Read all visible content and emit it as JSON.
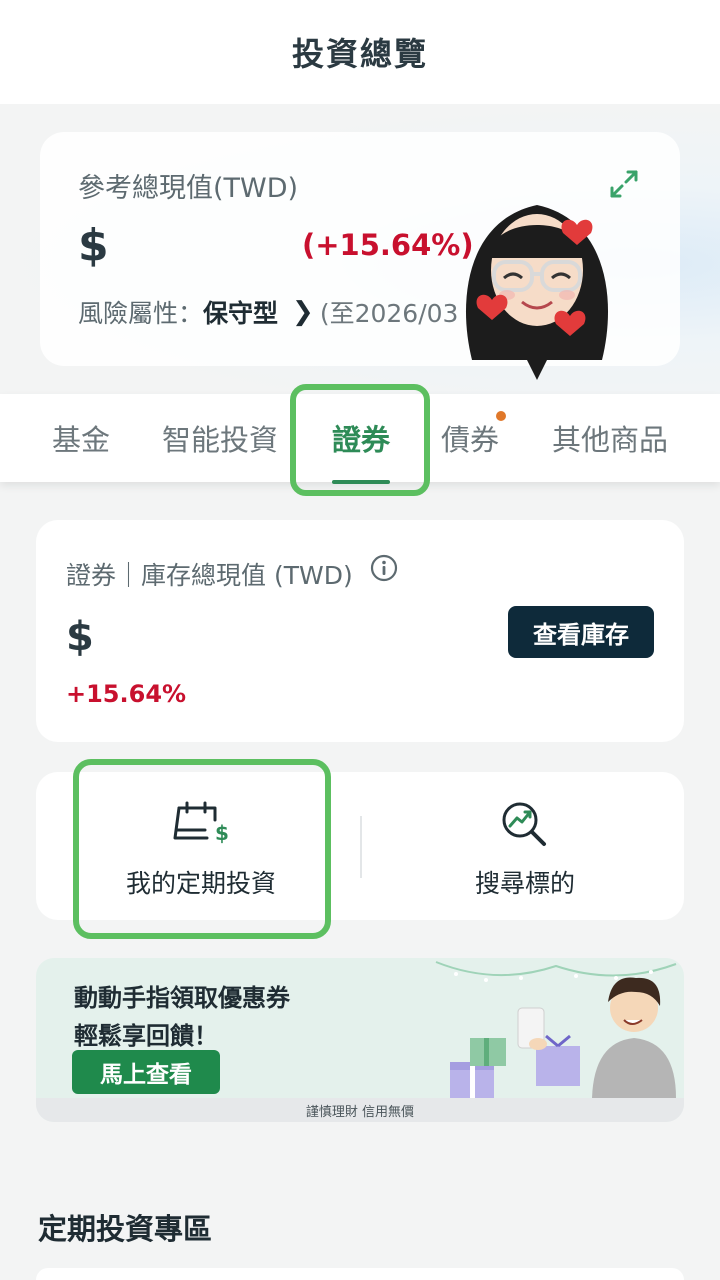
{
  "header": {
    "title": "投資總覽"
  },
  "summary": {
    "label": "參考總現值(TWD)",
    "currency": "$",
    "change": "(+15.64%)",
    "risk_label": "風險屬性：",
    "risk_value": "保守型",
    "risk_date": "(至2026/03"
  },
  "tabs": [
    {
      "label": "基金"
    },
    {
      "label": "智能投資"
    },
    {
      "label": "證券"
    },
    {
      "label": "債券"
    },
    {
      "label": "其他商品"
    }
  ],
  "active_tab": "證券",
  "stock": {
    "label": "證券｜庫存總現值 (TWD)",
    "currency": "$",
    "change": "+15.64%",
    "view_button": "查看庫存"
  },
  "actions": [
    {
      "label": "我的定期投資",
      "icon": "calendar-dollar-icon"
    },
    {
      "label": "搜尋標的",
      "icon": "search-trend-icon"
    }
  ],
  "promo": {
    "line1": "動動手指領取優惠券",
    "line2": "輕鬆享回饋！",
    "button": "馬上查看",
    "footer": "謹慎理財 信用無價"
  },
  "section": {
    "title": "定期投資專區"
  },
  "colors": {
    "accent_green": "#2e8b57",
    "positive_red": "#c8102e",
    "dark_button": "#0e2a3a",
    "highlight": "#5cbf60",
    "notification_dot": "#e0782a"
  }
}
